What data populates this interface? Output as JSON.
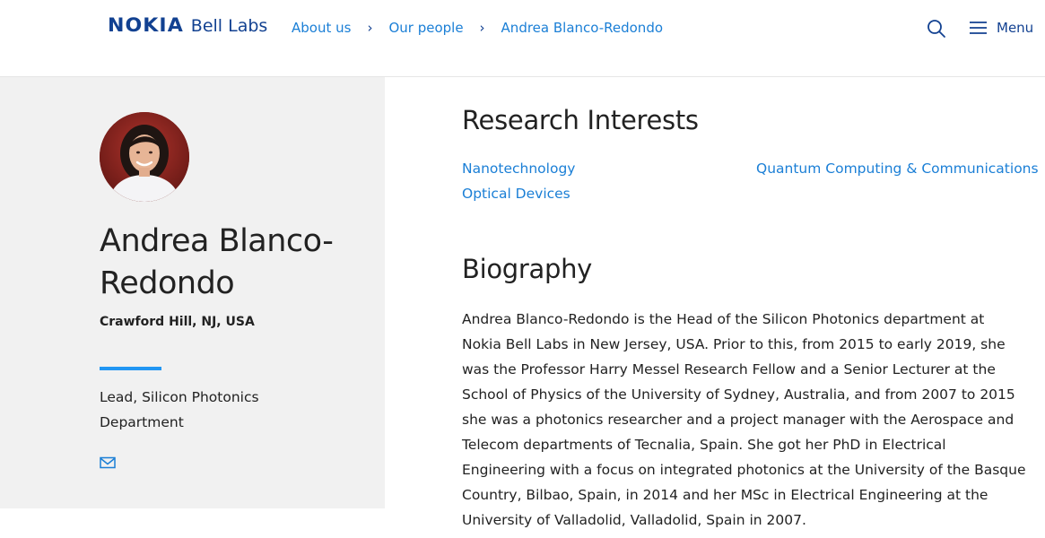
{
  "header": {
    "logo_nokia": "NOKIA",
    "logo_bell": "Bell Labs",
    "breadcrumbs": [
      "About us",
      "Our people",
      "Andrea Blanco-Redondo"
    ],
    "breadcrumb_separator": "›",
    "menu_label": "Menu",
    "icons": {
      "search": "search-icon",
      "menu": "hamburger-icon"
    }
  },
  "profile": {
    "name": "Andrea Blanco-Redondo",
    "location": "Crawford Hill, NJ, USA",
    "role": "Lead, Silicon Photonics Department",
    "contact_icon": "mail-icon"
  },
  "research": {
    "heading": "Research Interests",
    "interests": [
      "Nanotechnology",
      "Quantum Computing & Communications",
      "Optical Devices"
    ]
  },
  "biography": {
    "heading": "Biography",
    "text": "Andrea Blanco-Redondo is the Head of the Silicon Photonics department at Nokia Bell Labs in New Jersey, USA. Prior to this, from 2015 to early 2019, she was the Professor Harry Messel Research Fellow and a Senior Lecturer at the School of Physics of the University of Sydney, Australia, and from 2007 to 2015 she was a photonics researcher and a project manager with the Aerospace and Telecom departments of Tecnalia, Spain. She got her PhD in Electrical Engineering with a focus on integrated photonics at the University of the Basque Country, Bilbao, Spain, in 2014 and her MSc in Electrical Engineering at the University of Valladolid, Valladolid, Spain in 2007."
  },
  "colors": {
    "brand": "#124191",
    "link": "#1b7fd6",
    "accent_rule": "#2196f3",
    "panel_bg": "#f1f1f1"
  }
}
